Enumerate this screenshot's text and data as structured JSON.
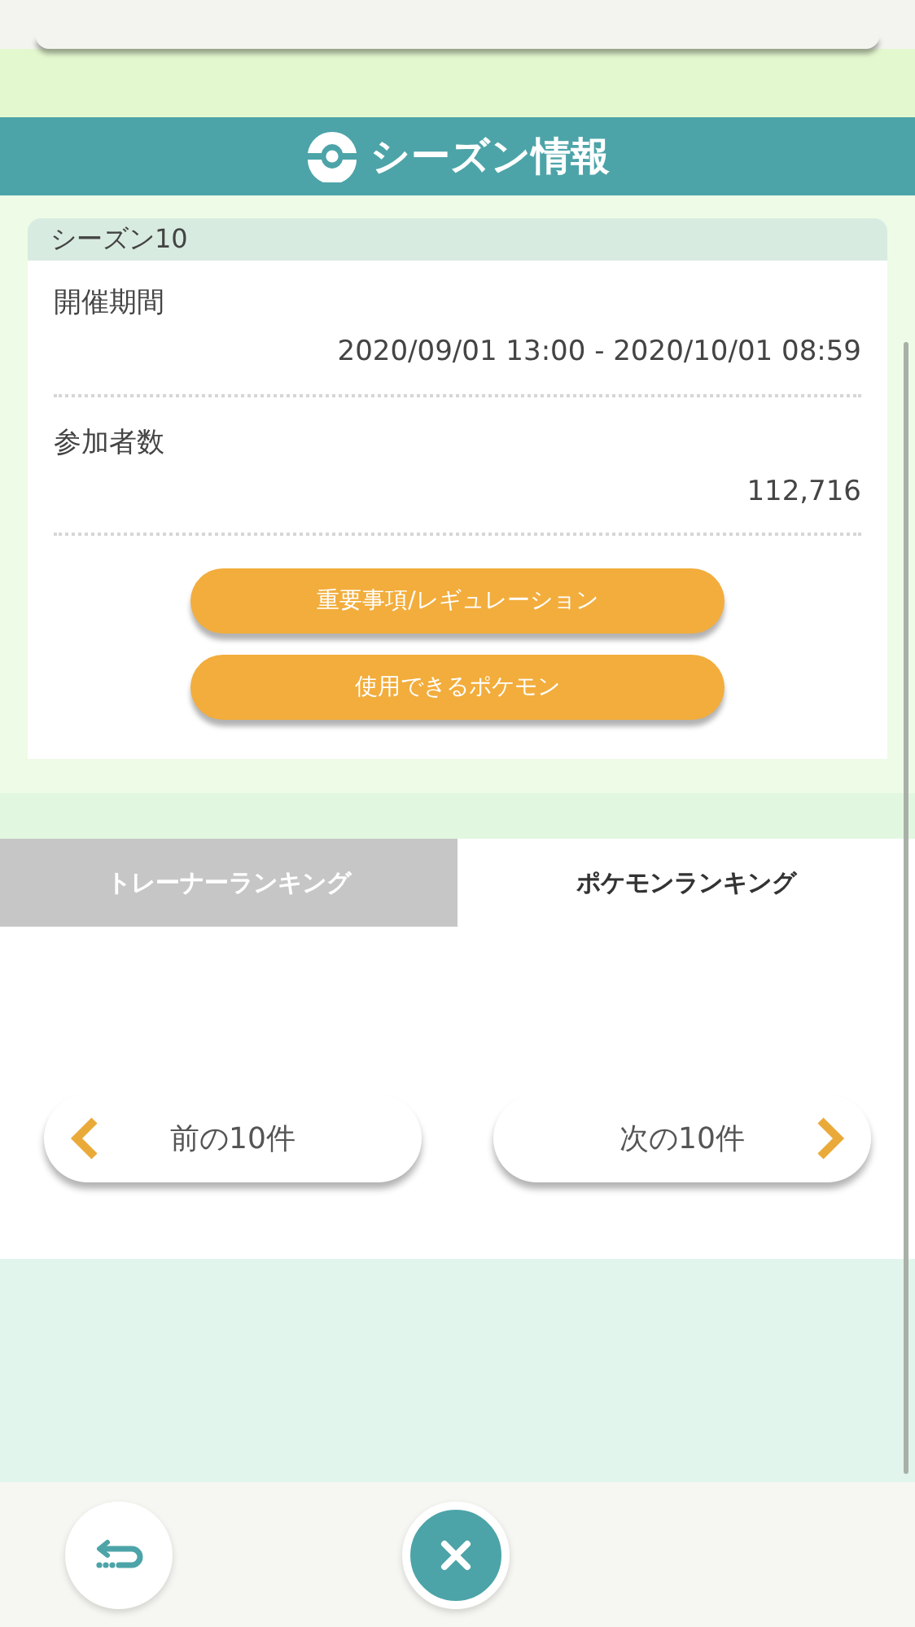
{
  "header": {
    "title": "シーズン情報"
  },
  "season": {
    "name": "シーズン10",
    "fields": [
      {
        "label": "開催期間",
        "value": "2020/09/01 13:00 - 2020/10/01 08:59"
      },
      {
        "label": "参加者数",
        "value": "112,716"
      }
    ],
    "buttons": [
      "重要事項/レギュレーション",
      "使用できるポケモン"
    ]
  },
  "tabs": [
    {
      "label": "トレーナーランキング",
      "selected": false
    },
    {
      "label": "ポケモンランキング",
      "selected": true
    }
  ],
  "pager": {
    "previous": "前の10件",
    "next": "次の10件"
  }
}
